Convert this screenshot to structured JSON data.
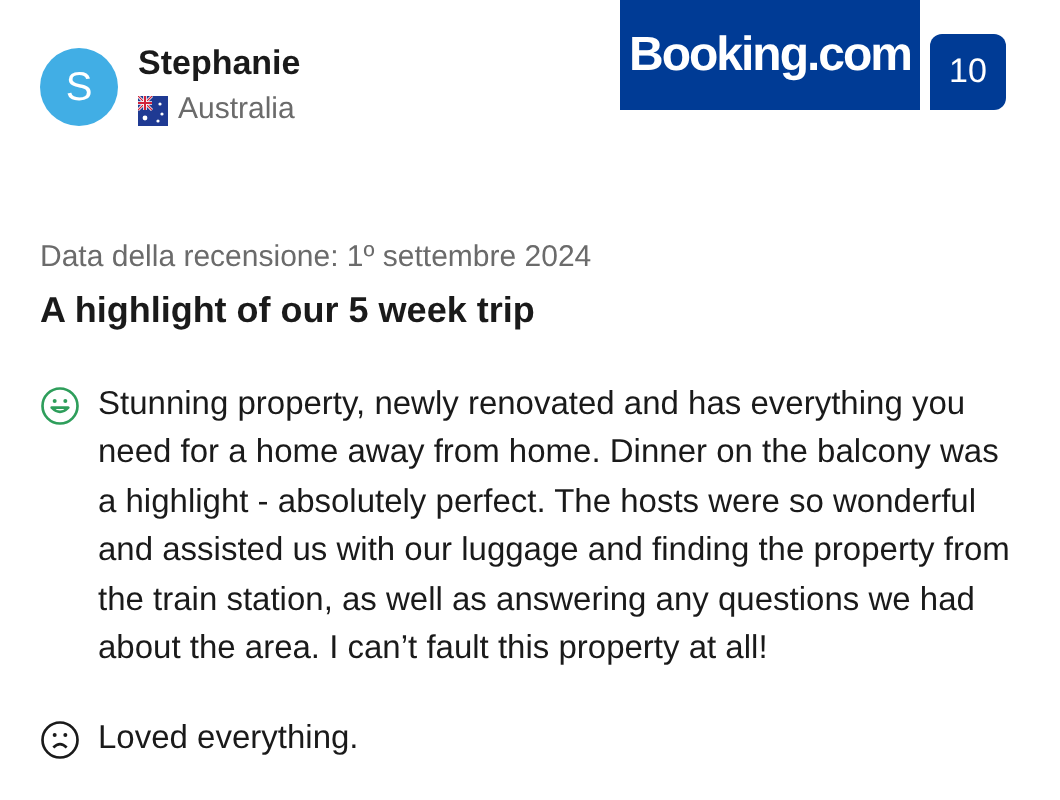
{
  "reviewer": {
    "initial": "S",
    "name": "Stephanie",
    "country": "Australia"
  },
  "brand": {
    "logo": "Booking.com",
    "score": "10"
  },
  "review_date": "Data della recensione: 1º settembre 2024",
  "title": "A highlight of our 5 week trip",
  "comments": [
    {
      "kind": "positive",
      "text": "Stunning property, newly renovated and has everything you need for a home away from home. Dinner on the balcony was a highlight - absolutely perfect. The hosts were so wonderful and assisted us with our luggage and finding the property from the train station, as well as answering any questions we had about the area. I can’t fault this property at all!"
    },
    {
      "kind": "negative",
      "text": "Loved everything."
    }
  ]
}
